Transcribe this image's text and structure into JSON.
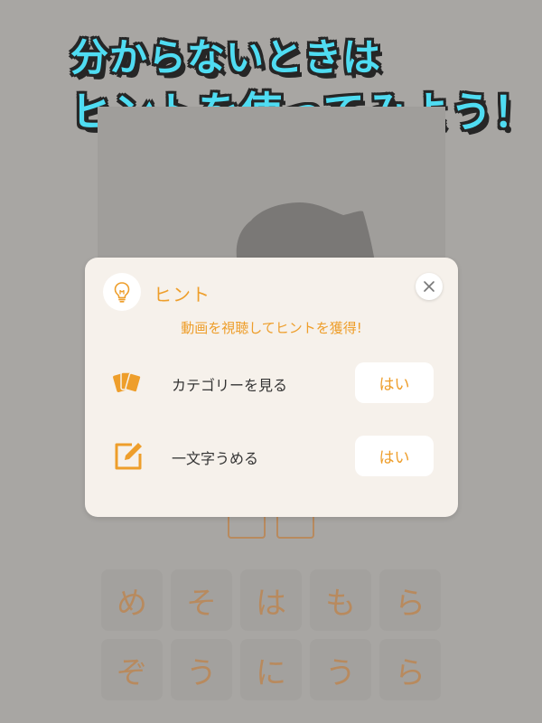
{
  "headline": {
    "line1": "分からないときは",
    "line2": "ヒントを使ってみよう！"
  },
  "keyboard": {
    "keys": [
      "め",
      "そ",
      "は",
      "も",
      "ら",
      "ぞ",
      "う",
      "に",
      "う",
      "ら"
    ]
  },
  "hint_dialog": {
    "title": "ヒント",
    "subtitle": "動画を視聴してヒントを獲得!",
    "options": [
      {
        "label": "カテゴリーを見る",
        "button": "はい",
        "icon": "cards-icon"
      },
      {
        "label": "一文字うめる",
        "button": "はい",
        "icon": "edit-icon"
      }
    ]
  },
  "colors": {
    "accent": "#ee9e2b",
    "headline": "#4fdcf2",
    "overlay": "#a8a6a3",
    "dialog_bg": "#f6f1eb"
  }
}
